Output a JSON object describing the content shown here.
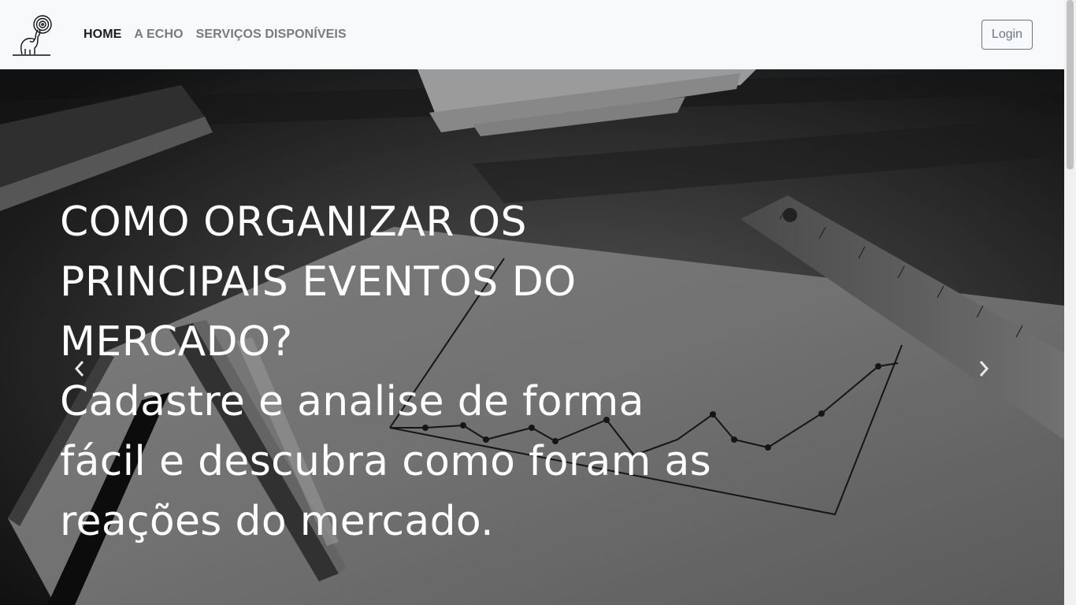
{
  "nav": {
    "logo_icon": "elephant-spiral-logo",
    "links": [
      {
        "label": "HOME",
        "active": true
      },
      {
        "label": "A ECHO",
        "active": false
      },
      {
        "label": "SERVIÇOS DISPONÍVEIS",
        "active": false
      }
    ],
    "login_label": "Login"
  },
  "hero": {
    "title": "COMO ORGANIZAR OS PRINCIPAIS EVENTOS DO MERCADO?",
    "subtitle": "Cadastre e analise de forma fácil e descubra como foram as reações do mercado.",
    "background_icon": "desk-notebook-chart-photo",
    "prev_icon": "chevron-left-icon",
    "next_icon": "chevron-right-icon"
  },
  "colors": {
    "navbar_bg": "#f8f9fa",
    "nav_active": "#1c1c1c",
    "nav_inactive": "#7a7a7a",
    "login_border": "#6c757d"
  }
}
